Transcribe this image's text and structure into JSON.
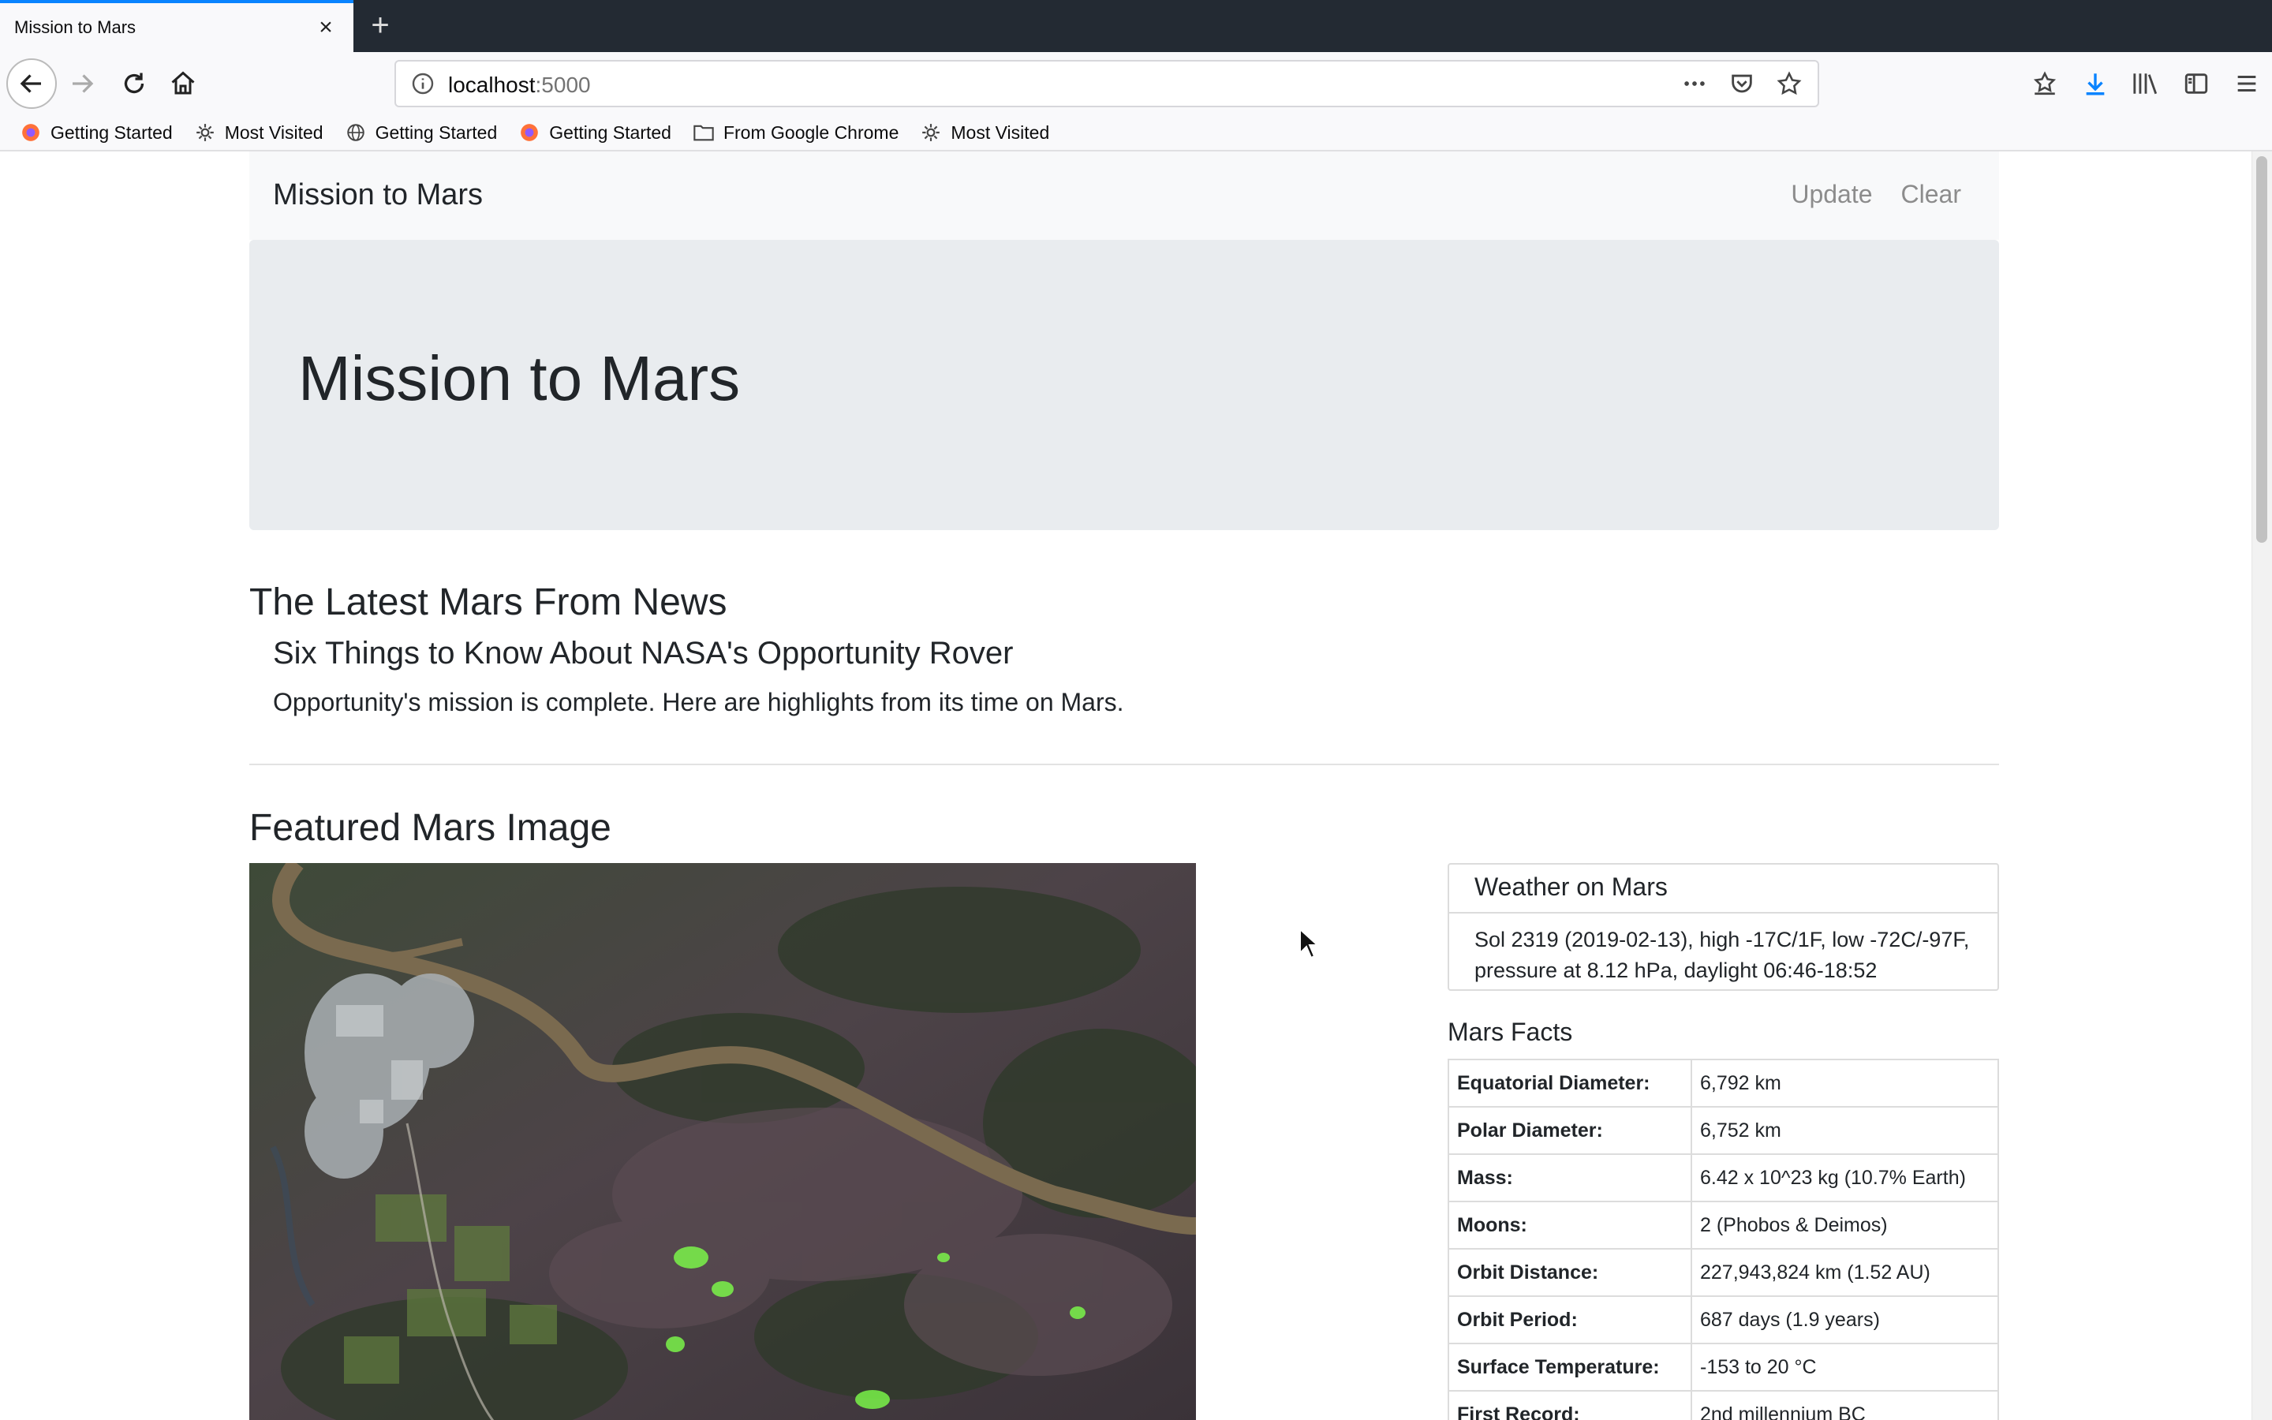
{
  "browser": {
    "tab_title": "Mission to Mars",
    "url_host": "localhost",
    "url_port": ":5000",
    "bookmarks": [
      {
        "label": "Getting Started",
        "icon": "firefox-icon"
      },
      {
        "label": "Most Visited",
        "icon": "gear-icon"
      },
      {
        "label": "Getting Started",
        "icon": "globe-icon"
      },
      {
        "label": "Getting Started",
        "icon": "firefox-icon"
      },
      {
        "label": "From Google Chrome",
        "icon": "folder-icon"
      },
      {
        "label": "Most Visited",
        "icon": "gear-icon"
      }
    ]
  },
  "nav": {
    "brand": "Mission to Mars",
    "links": [
      "Update",
      "Clear"
    ]
  },
  "jumbotron": {
    "title": "Mission to Mars"
  },
  "news": {
    "heading": "The Latest Mars From News",
    "title": "Six Things to Know About NASA's Opportunity Rover",
    "teaser": "Opportunity's mission is complete. Here are highlights from its time on Mars."
  },
  "featured": {
    "heading": "Featured Mars Image"
  },
  "weather": {
    "heading": "Weather on Mars",
    "text": "Sol 2319 (2019-02-13), high -17C/1F, low -72C/-97F, pressure at 8.12 hPa, daylight 06:46-18:52"
  },
  "facts": {
    "heading": "Mars Facts",
    "rows": [
      {
        "key": "Equatorial Diameter:",
        "value": "6,792 km"
      },
      {
        "key": "Polar Diameter:",
        "value": "6,752 km"
      },
      {
        "key": "Mass:",
        "value": "6.42 x 10^23 kg (10.7% Earth)"
      },
      {
        "key": "Moons:",
        "value": "2 (Phobos & Deimos)"
      },
      {
        "key": "Orbit Distance:",
        "value": "227,943,824 km (1.52 AU)"
      },
      {
        "key": "Orbit Period:",
        "value": "687 days (1.9 years)"
      },
      {
        "key": "Surface Temperature:",
        "value": "-153 to 20 °C"
      },
      {
        "key": "First Record:",
        "value": "2nd millennium BC"
      }
    ]
  }
}
